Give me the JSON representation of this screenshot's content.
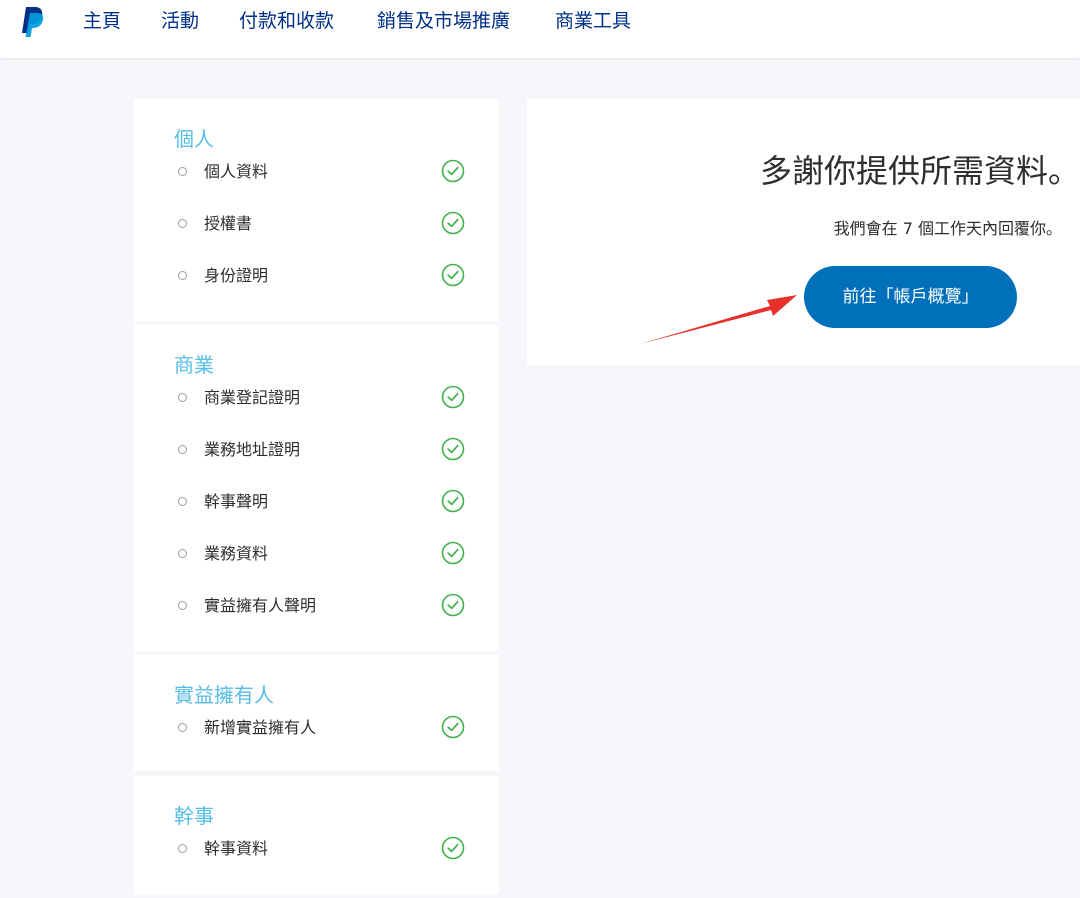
{
  "nav": {
    "logo_icon": "paypal-logo",
    "items": [
      "主頁",
      "活動",
      "付款和收款",
      "銷售及市場推廣",
      "商業工具"
    ]
  },
  "sections": [
    {
      "title": "個人",
      "items": [
        "個人資料",
        "授權書",
        "身份證明"
      ]
    },
    {
      "title": "商業",
      "items": [
        "商業登記證明",
        "業務地址證明",
        "幹事聲明",
        "業務資料",
        "實益擁有人聲明"
      ]
    },
    {
      "title": "實益擁有人",
      "items": [
        "新增實益擁有人"
      ]
    },
    {
      "title": "幹事",
      "items": [
        "幹事資料"
      ]
    }
  ],
  "item_status_icon": "check-circle-icon",
  "confirmation": {
    "heading": "多謝你提供所需資料。",
    "message": "我們會在 7 個工作天內回覆你。",
    "button_label": "前往「帳戶概覽」"
  },
  "colors": {
    "nav_text": "#003087",
    "section_title": "#57bde6",
    "check": "#3eb14a",
    "button": "#0070ba",
    "annotation_arrow": "#e8302a"
  }
}
